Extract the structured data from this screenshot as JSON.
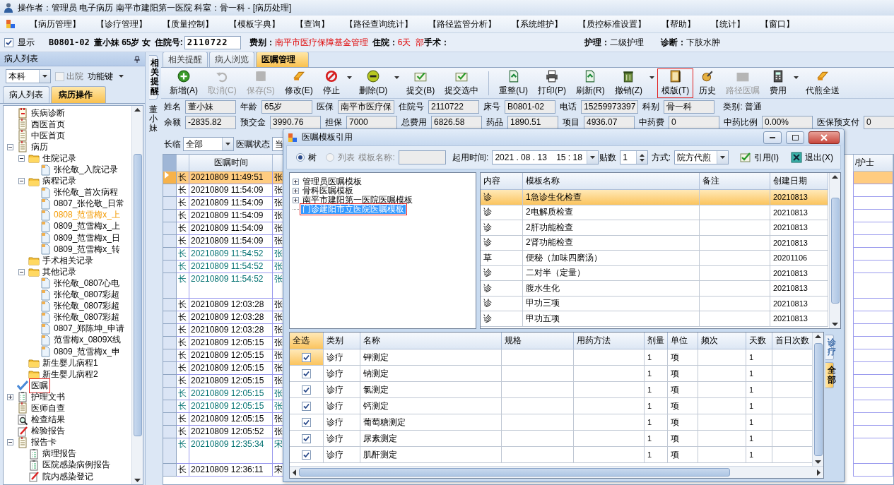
{
  "title_bar": "操作者：管理员 电子病历  南平市建阳第一医院  科室：骨一科 - [病历处理]",
  "menu": [
    "【病历管理】",
    "【诊疗管理】",
    "【质量控制】",
    "【模板字典】",
    "【查询】",
    "【路径查询统计】",
    "【路径监管分析】",
    "【系统维护】",
    "【质控标准设置】",
    "【帮助】",
    "【统计】",
    "【窗口】"
  ],
  "patient_bar": {
    "show": {
      "label": "显示",
      "checked": true
    },
    "bed": "B0801-02",
    "patient": "董小妹 65岁 女",
    "admission_label": "住院号:",
    "admission_no": "2110722",
    "fee_label": "费别：",
    "fee_value": "南平市医疗保障基金管理",
    "stay_label": "住院：",
    "stay_value": "6天",
    "surgery_prefix": "部",
    "surgery_label": "手术：",
    "nursing_label": "护理：",
    "nursing_value": "二级护理",
    "diagnosis_label": "诊断：",
    "diagnosis_value": "下肢水肿"
  },
  "left_panel": {
    "title": "病人列表",
    "dept": "本科",
    "discharged": {
      "label": "出院",
      "checked": false
    },
    "function_key": "功能键",
    "tabs": [
      {
        "label": "病人列表",
        "selected": false
      },
      {
        "label": "病历操作",
        "selected": true
      }
    ],
    "tree": [
      {
        "label": "疾病诊断",
        "kind": "calendar",
        "selected": false
      },
      {
        "label": "西医首页",
        "kind": "notebook",
        "selected": false
      },
      {
        "label": "中医首页",
        "kind": "notebook",
        "selected": false
      },
      {
        "label": "病历",
        "kind": "notebook",
        "selected": false,
        "expanded": true,
        "children": [
          {
            "label": "住院记录",
            "kind": "folder",
            "selected": false,
            "expanded": true,
            "children": [
              {
                "label": "张伦敬_入院记录",
                "kind": "document",
                "selected": false
              }
            ]
          },
          {
            "label": "病程记录",
            "kind": "folder",
            "selected": false,
            "expanded": true,
            "children": [
              {
                "label": "张伦敬_首次病程",
                "kind": "document",
                "selected": false
              },
              {
                "label": "0807_张伦敬_日常",
                "kind": "document",
                "selected": false
              },
              {
                "label": "0808_范雪梅x_上",
                "kind": "document",
                "selected": true
              },
              {
                "label": "0809_范雪梅x_上",
                "kind": "document",
                "selected": false
              },
              {
                "label": "0809_范雪梅x_日",
                "kind": "document",
                "selected": false
              },
              {
                "label": "0809_范雪梅x_转",
                "kind": "document",
                "selected": false
              }
            ]
          },
          {
            "label": "手术相关记录",
            "kind": "folder",
            "selected": false
          },
          {
            "label": "其他记录",
            "kind": "folder",
            "selected": false,
            "expanded": true,
            "children": [
              {
                "label": "张伦敬_0807心电",
                "kind": "document",
                "selected": false
              },
              {
                "label": "张伦敬_0807彩超",
                "kind": "document",
                "selected": false
              },
              {
                "label": "张伦敬_0807彩超",
                "kind": "document",
                "selected": false
              },
              {
                "label": "张伦敬_0807彩超",
                "kind": "document",
                "selected": false
              },
              {
                "label": "0807_郑陈坤_申请",
                "kind": "document",
                "selected": false
              },
              {
                "label": "范雪梅x_0809X线",
                "kind": "document",
                "selected": false
              },
              {
                "label": "0809_范雪梅x_申",
                "kind": "document",
                "selected": false
              }
            ]
          },
          {
            "label": "新生婴儿病程1",
            "kind": "folder",
            "selected": false
          },
          {
            "label": "新生婴儿病程2",
            "kind": "folder",
            "selected": false
          }
        ]
      },
      {
        "label": "医嘱",
        "kind": "check",
        "selected": false,
        "marked": true
      },
      {
        "label": "护理文书",
        "kind": "checklist",
        "selected": false,
        "expanded": false
      },
      {
        "label": "医师自查",
        "kind": "notebook",
        "selected": false
      },
      {
        "label": "检查结果",
        "kind": "search",
        "selected": false
      },
      {
        "label": "检验报告",
        "kind": "pen",
        "selected": false
      },
      {
        "label": "报告卡",
        "kind": "notebook",
        "selected": false,
        "expanded": true,
        "children": [
          {
            "label": "病理报告",
            "kind": "checklist",
            "selected": false
          },
          {
            "label": "医院感染病例报告",
            "kind": "checklist",
            "selected": false
          },
          {
            "label": "院内感染登记",
            "kind": "pen",
            "selected": false
          }
        ]
      }
    ]
  },
  "side_tab": "相关提醒",
  "tabs": [
    {
      "label": "相关提醒",
      "selected": false
    },
    {
      "label": "病人浏览",
      "selected": false
    },
    {
      "label": "医嘱管理",
      "selected": true
    }
  ],
  "toolbar": [
    {
      "label": "新增(A)",
      "disabled": false
    },
    {
      "label": "取消(C)",
      "disabled": true
    },
    {
      "label": "保存(S)",
      "disabled": true
    },
    {
      "label": "修改(E)",
      "disabled": false
    },
    {
      "label": "停止",
      "disabled": false,
      "dropdown": true
    },
    {
      "label": "删除(D)",
      "disabled": false,
      "dropdown": true
    },
    {
      "label": "提交(B)",
      "disabled": false
    },
    {
      "label": "提交选中",
      "disabled": false
    },
    {
      "label": "重整(U)",
      "disabled": false,
      "separator_before": true
    },
    {
      "label": "打印(P)",
      "disabled": false
    },
    {
      "label": "刷新(R)",
      "disabled": false
    },
    {
      "label": "撤销(Z)",
      "disabled": false,
      "dropdown": true
    },
    {
      "label": "模版(T)",
      "disabled": false,
      "marked": true
    },
    {
      "label": "历史",
      "disabled": false
    },
    {
      "label": "路径医嘱",
      "disabled": true
    },
    {
      "label": "费用",
      "disabled": false,
      "dropdown": true
    },
    {
      "label": "代煎全送",
      "disabled": false
    }
  ],
  "patient_strip": "董小妹",
  "info_rows": [
    [
      {
        "label": "姓名",
        "value": "董小妹"
      },
      {
        "label": "年龄",
        "value": "65岁"
      },
      {
        "label": "医保",
        "value": "南平市医疗保"
      },
      {
        "label": "住院号",
        "value": "2110722"
      },
      {
        "label": "床号",
        "value": "B0801-02"
      },
      {
        "label": "电话",
        "value": "15259973397"
      },
      {
        "label": "科别",
        "value": "骨一科"
      },
      {
        "label": "类别:",
        "value": "普通",
        "kind": "plain"
      }
    ],
    [
      {
        "label": "余额",
        "value": "-2835.82"
      },
      {
        "label": "预交金",
        "value": "3990.76"
      },
      {
        "label": "担保",
        "value": "7000"
      },
      {
        "label": "总费用",
        "value": "6826.58"
      },
      {
        "label": "药品",
        "value": "1890.51"
      },
      {
        "label": "项目",
        "value": "4936.07"
      },
      {
        "label": "中药费",
        "value": "0"
      },
      {
        "label": "中药比例",
        "value": "0.00%"
      },
      {
        "label": "医保预支付",
        "value": "0"
      }
    ]
  ],
  "filter": {
    "type_label": "长临",
    "type_value": "全部",
    "status_label": "医嘱状态",
    "status_value": "当"
  },
  "orders": {
    "time_header": "医嘱时间",
    "last_header": "/护士",
    "rows": [
      {
        "type": "长",
        "time": "20210809 11:49:51",
        "doctor": "张",
        "emphasized": false,
        "selected": true,
        "tall": false
      },
      {
        "type": "长",
        "time": "20210809 11:54:09",
        "doctor": "张",
        "emphasized": false,
        "selected": false,
        "tall": false
      },
      {
        "type": "长",
        "time": "20210809 11:54:09",
        "doctor": "张",
        "emphasized": false,
        "selected": false,
        "tall": false
      },
      {
        "type": "长",
        "time": "20210809 11:54:09",
        "doctor": "张",
        "emphasized": false,
        "selected": false,
        "tall": false
      },
      {
        "type": "长",
        "time": "20210809 11:54:09",
        "doctor": "张",
        "emphasized": false,
        "selected": false,
        "tall": false
      },
      {
        "type": "长",
        "time": "20210809 11:54:09",
        "doctor": "张",
        "emphasized": false,
        "selected": false,
        "tall": false
      },
      {
        "type": "长",
        "time": "20210809 11:54:52",
        "doctor": "张",
        "emphasized": true,
        "selected": false,
        "tall": false
      },
      {
        "type": "长",
        "time": "20210809 11:54:52",
        "doctor": "张",
        "emphasized": true,
        "selected": false,
        "tall": false
      },
      {
        "type": "长",
        "time": "20210809 11:54:52",
        "doctor": "张",
        "emphasized": true,
        "selected": false,
        "tall": true
      },
      {
        "type": "长",
        "time": "20210809 12:03:28",
        "doctor": "张",
        "emphasized": false,
        "selected": false,
        "tall": false
      },
      {
        "type": "长",
        "time": "20210809 12:03:28",
        "doctor": "张",
        "emphasized": false,
        "selected": false,
        "tall": false
      },
      {
        "type": "长",
        "time": "20210809 12:03:28",
        "doctor": "张",
        "emphasized": false,
        "selected": false,
        "tall": false
      },
      {
        "type": "长",
        "time": "20210809 12:05:15",
        "doctor": "张",
        "emphasized": false,
        "selected": false,
        "tall": false
      },
      {
        "type": "长",
        "time": "20210809 12:05:15",
        "doctor": "张",
        "emphasized": false,
        "selected": false,
        "tall": false
      },
      {
        "type": "长",
        "time": "20210809 12:05:15",
        "doctor": "张",
        "emphasized": false,
        "selected": false,
        "tall": false
      },
      {
        "type": "长",
        "time": "20210809 12:05:15",
        "doctor": "张",
        "emphasized": false,
        "selected": false,
        "tall": false
      },
      {
        "type": "长",
        "time": "20210809 12:05:15",
        "doctor": "张",
        "emphasized": true,
        "selected": false,
        "tall": false
      },
      {
        "type": "长",
        "time": "20210809 12:05:15",
        "doctor": "张",
        "emphasized": true,
        "selected": false,
        "tall": false
      },
      {
        "type": "长",
        "time": "20210809 12:05:15",
        "doctor": "张",
        "emphasized": false,
        "selected": false,
        "tall": false
      },
      {
        "type": "长",
        "time": "20210809 12:05:52",
        "doctor": "张",
        "emphasized": false,
        "selected": false,
        "tall": false
      },
      {
        "type": "长",
        "time": "20210809 12:35:34",
        "doctor": "宋",
        "emphasized": true,
        "selected": false,
        "tall": true
      },
      {
        "type": "长",
        "time": "20210809 12:36:11",
        "doctor": "宋",
        "emphasized": false,
        "selected": false,
        "tall": false
      }
    ]
  },
  "dialog": {
    "title": "医嘱模板引用",
    "view_modes": [
      {
        "label": "树",
        "selected": true,
        "disabled": false
      },
      {
        "label": "列表",
        "selected": false,
        "disabled": true
      }
    ],
    "name_label": "模板名称:",
    "start_label": "起用时间:",
    "start_value": "2021 . 08 . 13    15 : 18",
    "doses_label": "贴数",
    "doses_value": "1",
    "method_label": "方式:",
    "method_value": "院方代煎",
    "buttons": [
      "引用(I)",
      "退出(X)"
    ],
    "template_tree": [
      {
        "label": "管理员医嘱模板",
        "expandable": true,
        "selected": false
      },
      {
        "label": "骨科医嘱模板",
        "expandable": true,
        "selected": false
      },
      {
        "label": "南平市建阳第一医院医嘱模板",
        "expandable": true,
        "selected": false
      },
      {
        "label": "门诊建阳市立医院医嘱模板",
        "expandable": false,
        "selected": true,
        "marked": true
      }
    ],
    "template_columns": [
      "内容",
      "模板名称",
      "备注",
      "创建日期"
    ],
    "templates": [
      {
        "content": "诊",
        "name": "1急诊生化检查",
        "date": "20210813",
        "selected": true
      },
      {
        "content": "诊",
        "name": "2电解质检查",
        "date": "20210813",
        "selected": false
      },
      {
        "content": "诊",
        "name": "2肝功能检查",
        "date": "20210813",
        "selected": false
      },
      {
        "content": "诊",
        "name": "2肾功能检查",
        "date": "20210813",
        "selected": false
      },
      {
        "content": "草",
        "name": "便秘（加味四磨汤）",
        "date": "20201106",
        "selected": false
      },
      {
        "content": "诊",
        "name": "二对半（定量）",
        "date": "20210813",
        "selected": false
      },
      {
        "content": "诊",
        "name": "腹水生化",
        "date": "20210813",
        "selected": false
      },
      {
        "content": "诊",
        "name": "甲功三项",
        "date": "20210813",
        "selected": false
      },
      {
        "content": "诊",
        "name": "甲功五项",
        "date": "20210813",
        "selected": false
      }
    ],
    "item_columns": [
      "全选",
      "类别",
      "名称",
      "规格",
      "用药方法",
      "剂量",
      "单位",
      "频次",
      "天数",
      "首日次数"
    ],
    "items": [
      {
        "checked": true,
        "category": "诊疗",
        "name": "钾测定",
        "dose": "1",
        "unit": "项",
        "days": "1",
        "selected": true
      },
      {
        "checked": true,
        "category": "诊疗",
        "name": "钠测定",
        "dose": "1",
        "unit": "项",
        "days": "1",
        "selected": false
      },
      {
        "checked": true,
        "category": "诊疗",
        "name": "氯测定",
        "dose": "1",
        "unit": "项",
        "days": "1",
        "selected": false
      },
      {
        "checked": true,
        "category": "诊疗",
        "name": "钙测定",
        "dose": "1",
        "unit": "项",
        "days": "1",
        "selected": false
      },
      {
        "checked": true,
        "category": "诊疗",
        "name": "葡萄糖测定",
        "dose": "1",
        "unit": "项",
        "days": "1",
        "selected": false
      },
      {
        "checked": true,
        "category": "诊疗",
        "name": "尿素测定",
        "dose": "1",
        "unit": "项",
        "days": "1",
        "selected": false
      },
      {
        "checked": true,
        "category": "诊疗",
        "name": "肌酐测定",
        "dose": "1",
        "unit": "项",
        "days": "1",
        "selected": false
      }
    ],
    "side_tabs": [
      {
        "label": "诊疗",
        "selected": false
      },
      {
        "label": "全部",
        "selected": true
      }
    ]
  }
}
